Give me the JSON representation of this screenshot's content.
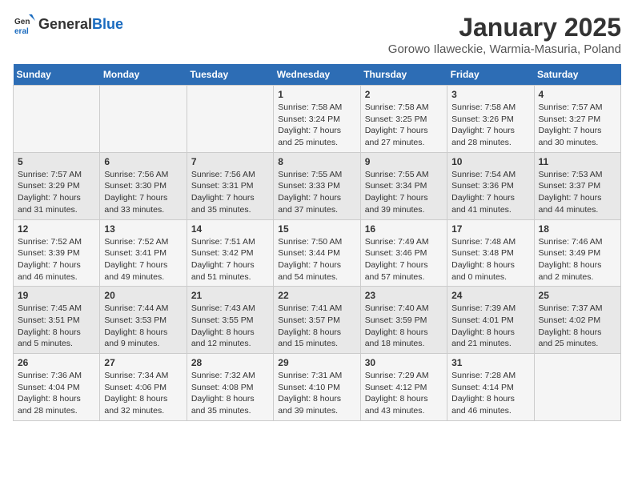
{
  "header": {
    "logo_general": "General",
    "logo_blue": "Blue",
    "title": "January 2025",
    "subtitle": "Gorowo Ilaweckie, Warmia-Masuria, Poland"
  },
  "days_of_week": [
    "Sunday",
    "Monday",
    "Tuesday",
    "Wednesday",
    "Thursday",
    "Friday",
    "Saturday"
  ],
  "weeks": [
    [
      {
        "day": "",
        "info": ""
      },
      {
        "day": "",
        "info": ""
      },
      {
        "day": "",
        "info": ""
      },
      {
        "day": "1",
        "info": "Sunrise: 7:58 AM\nSunset: 3:24 PM\nDaylight: 7 hours\nand 25 minutes."
      },
      {
        "day": "2",
        "info": "Sunrise: 7:58 AM\nSunset: 3:25 PM\nDaylight: 7 hours\nand 27 minutes."
      },
      {
        "day": "3",
        "info": "Sunrise: 7:58 AM\nSunset: 3:26 PM\nDaylight: 7 hours\nand 28 minutes."
      },
      {
        "day": "4",
        "info": "Sunrise: 7:57 AM\nSunset: 3:27 PM\nDaylight: 7 hours\nand 30 minutes."
      }
    ],
    [
      {
        "day": "5",
        "info": "Sunrise: 7:57 AM\nSunset: 3:29 PM\nDaylight: 7 hours\nand 31 minutes."
      },
      {
        "day": "6",
        "info": "Sunrise: 7:56 AM\nSunset: 3:30 PM\nDaylight: 7 hours\nand 33 minutes."
      },
      {
        "day": "7",
        "info": "Sunrise: 7:56 AM\nSunset: 3:31 PM\nDaylight: 7 hours\nand 35 minutes."
      },
      {
        "day": "8",
        "info": "Sunrise: 7:55 AM\nSunset: 3:33 PM\nDaylight: 7 hours\nand 37 minutes."
      },
      {
        "day": "9",
        "info": "Sunrise: 7:55 AM\nSunset: 3:34 PM\nDaylight: 7 hours\nand 39 minutes."
      },
      {
        "day": "10",
        "info": "Sunrise: 7:54 AM\nSunset: 3:36 PM\nDaylight: 7 hours\nand 41 minutes."
      },
      {
        "day": "11",
        "info": "Sunrise: 7:53 AM\nSunset: 3:37 PM\nDaylight: 7 hours\nand 44 minutes."
      }
    ],
    [
      {
        "day": "12",
        "info": "Sunrise: 7:52 AM\nSunset: 3:39 PM\nDaylight: 7 hours\nand 46 minutes."
      },
      {
        "day": "13",
        "info": "Sunrise: 7:52 AM\nSunset: 3:41 PM\nDaylight: 7 hours\nand 49 minutes."
      },
      {
        "day": "14",
        "info": "Sunrise: 7:51 AM\nSunset: 3:42 PM\nDaylight: 7 hours\nand 51 minutes."
      },
      {
        "day": "15",
        "info": "Sunrise: 7:50 AM\nSunset: 3:44 PM\nDaylight: 7 hours\nand 54 minutes."
      },
      {
        "day": "16",
        "info": "Sunrise: 7:49 AM\nSunset: 3:46 PM\nDaylight: 7 hours\nand 57 minutes."
      },
      {
        "day": "17",
        "info": "Sunrise: 7:48 AM\nSunset: 3:48 PM\nDaylight: 8 hours\nand 0 minutes."
      },
      {
        "day": "18",
        "info": "Sunrise: 7:46 AM\nSunset: 3:49 PM\nDaylight: 8 hours\nand 2 minutes."
      }
    ],
    [
      {
        "day": "19",
        "info": "Sunrise: 7:45 AM\nSunset: 3:51 PM\nDaylight: 8 hours\nand 5 minutes."
      },
      {
        "day": "20",
        "info": "Sunrise: 7:44 AM\nSunset: 3:53 PM\nDaylight: 8 hours\nand 9 minutes."
      },
      {
        "day": "21",
        "info": "Sunrise: 7:43 AM\nSunset: 3:55 PM\nDaylight: 8 hours\nand 12 minutes."
      },
      {
        "day": "22",
        "info": "Sunrise: 7:41 AM\nSunset: 3:57 PM\nDaylight: 8 hours\nand 15 minutes."
      },
      {
        "day": "23",
        "info": "Sunrise: 7:40 AM\nSunset: 3:59 PM\nDaylight: 8 hours\nand 18 minutes."
      },
      {
        "day": "24",
        "info": "Sunrise: 7:39 AM\nSunset: 4:01 PM\nDaylight: 8 hours\nand 21 minutes."
      },
      {
        "day": "25",
        "info": "Sunrise: 7:37 AM\nSunset: 4:02 PM\nDaylight: 8 hours\nand 25 minutes."
      }
    ],
    [
      {
        "day": "26",
        "info": "Sunrise: 7:36 AM\nSunset: 4:04 PM\nDaylight: 8 hours\nand 28 minutes."
      },
      {
        "day": "27",
        "info": "Sunrise: 7:34 AM\nSunset: 4:06 PM\nDaylight: 8 hours\nand 32 minutes."
      },
      {
        "day": "28",
        "info": "Sunrise: 7:32 AM\nSunset: 4:08 PM\nDaylight: 8 hours\nand 35 minutes."
      },
      {
        "day": "29",
        "info": "Sunrise: 7:31 AM\nSunset: 4:10 PM\nDaylight: 8 hours\nand 39 minutes."
      },
      {
        "day": "30",
        "info": "Sunrise: 7:29 AM\nSunset: 4:12 PM\nDaylight: 8 hours\nand 43 minutes."
      },
      {
        "day": "31",
        "info": "Sunrise: 7:28 AM\nSunset: 4:14 PM\nDaylight: 8 hours\nand 46 minutes."
      },
      {
        "day": "",
        "info": ""
      }
    ]
  ]
}
